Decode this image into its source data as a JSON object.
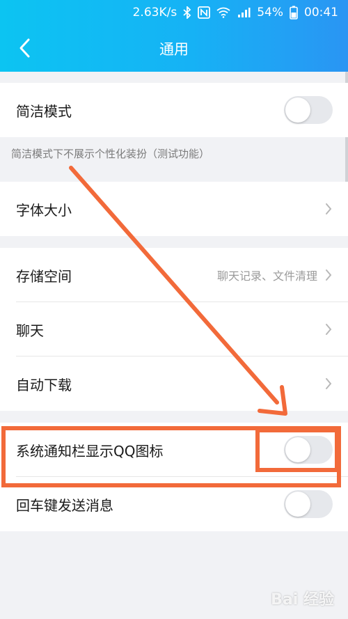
{
  "status_bar": {
    "speed": "2.63K/s",
    "battery": "54%",
    "time": "00:41"
  },
  "nav": {
    "title": "通用"
  },
  "sections": {
    "simple_mode": {
      "label": "简洁模式",
      "toggle_on": false,
      "hint": "简洁模式下不展示个性化装扮（测试功能）"
    },
    "font_size": {
      "label": "字体大小"
    },
    "storage": {
      "label": "存储空间",
      "value": "聊天记录、文件清理"
    },
    "chat": {
      "label": "聊天"
    },
    "auto_download": {
      "label": "自动下载"
    },
    "notify_icon": {
      "label": "系统通知栏显示QQ图标",
      "toggle_on": false
    },
    "enter_send": {
      "label": "回车键发送消息",
      "toggle_on": false
    }
  },
  "watermark": "Bai 经验",
  "colors": {
    "header_start": "#0cc4f2",
    "header_end": "#2a95f3",
    "annotation": "#f26a3a",
    "background": "#f1f2f5"
  }
}
